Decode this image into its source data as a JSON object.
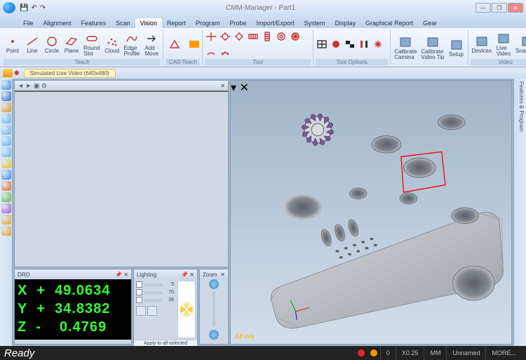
{
  "window": {
    "title": "CMM-Manager - Part1"
  },
  "winbtns": {
    "min": "—",
    "max": "❐",
    "close": "✕"
  },
  "tabs": [
    {
      "id": "file",
      "label": "File"
    },
    {
      "id": "alignment",
      "label": "Alignment"
    },
    {
      "id": "features",
      "label": "Features"
    },
    {
      "id": "scan",
      "label": "Scan"
    },
    {
      "id": "vision",
      "label": "Vision",
      "active": true
    },
    {
      "id": "report",
      "label": "Report"
    },
    {
      "id": "program",
      "label": "Program"
    },
    {
      "id": "probe",
      "label": "Probe"
    },
    {
      "id": "importexport",
      "label": "Import/Export"
    },
    {
      "id": "system",
      "label": "System"
    },
    {
      "id": "display",
      "label": "Display"
    },
    {
      "id": "graphical",
      "label": "Graphical Report"
    },
    {
      "id": "gear",
      "label": "Gear"
    }
  ],
  "ribbon": {
    "teach_group": "Teach",
    "teach": [
      {
        "id": "point",
        "label": "Point"
      },
      {
        "id": "line",
        "label": "Line"
      },
      {
        "id": "circle",
        "label": "Circle"
      },
      {
        "id": "plane",
        "label": "Plane"
      },
      {
        "id": "roundslot",
        "label": "Round\nSlot"
      },
      {
        "id": "cloud",
        "label": "Cloud"
      },
      {
        "id": "edgeprofile",
        "label": "Edge\nProfile"
      },
      {
        "id": "addmove",
        "label": "Add\nMove"
      }
    ],
    "cadteach_group": "CAD Teach",
    "tool_group": "Tool",
    "tooloptions_group": "Tool Options",
    "camera_group": " ",
    "camera": [
      {
        "id": "calibcam",
        "label": "Calibrate\nCamera"
      },
      {
        "id": "calibvid",
        "label": "Calibrate\nVideo Tip"
      },
      {
        "id": "setup",
        "label": "Setup"
      }
    ],
    "video_group": "Video",
    "video": [
      {
        "id": "devices",
        "label": "Devices"
      },
      {
        "id": "livevideo",
        "label": "Live\nVideo"
      },
      {
        "id": "snapshot",
        "label": "Snapshot"
      }
    ]
  },
  "doc_tab": "Simulated Live Video (640x480)",
  "left_tool_colors": [
    "#3a87e8",
    "#2a68c4",
    "#e88f1c",
    "#5fb5e8",
    "#5fb5e8",
    "#5fb5e8",
    "#5fb5e8",
    "#e8c21c",
    "#3a87e8",
    "#e86a1c",
    "#5fb53a",
    "#aa55cc",
    "#e8a01c",
    "#e8a01c"
  ],
  "right_panel_tabs": "Features  &  Program",
  "dro": {
    "title": "DRO",
    "x_label": "X",
    "x_sign": "+",
    "x_val": "49.0634",
    "y_label": "Y",
    "y_sign": "+",
    "y_val": "34.8382",
    "z_label": "Z",
    "z_sign": "-",
    "z_val": "0.4769"
  },
  "lighting": {
    "title": "Lighting",
    "s1": "5",
    "s2": "70",
    "s3": "38",
    "apply": "Apply to all selected commands"
  },
  "zoom": {
    "title": "Zoom"
  },
  "view3d": {
    "axis_scale": "4.0 mm"
  },
  "status": {
    "ready": "Ready",
    "v1": "0",
    "v2": "X0.25",
    "v3": "MM",
    "v4": "Unnamed",
    "v5": "MORE..."
  }
}
